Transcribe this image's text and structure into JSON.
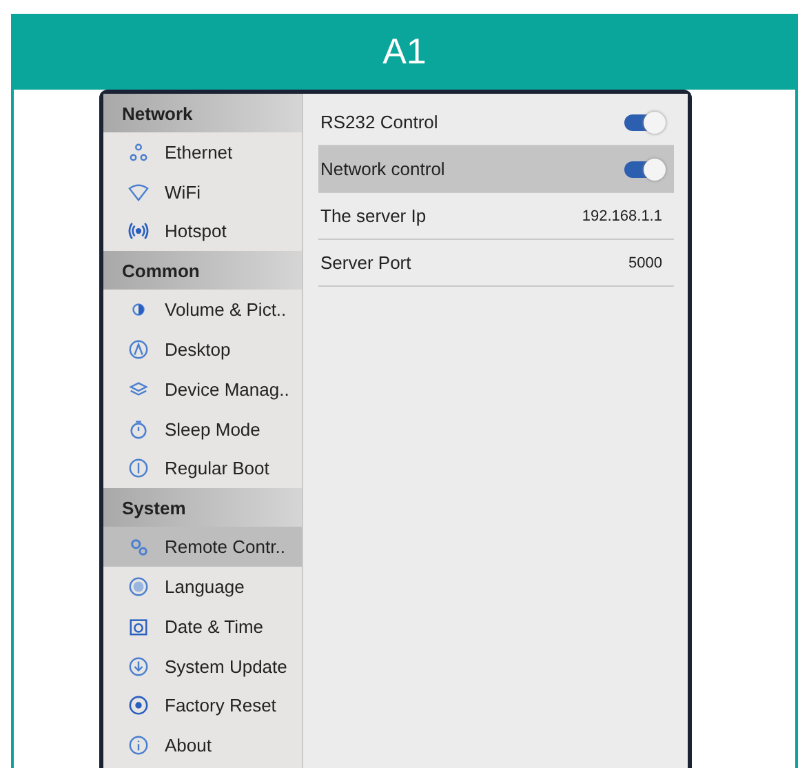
{
  "header": {
    "title": "A1"
  },
  "sidebar": {
    "groups": [
      {
        "title": "Network",
        "items": [
          {
            "label": "Ethernet",
            "selected": false
          },
          {
            "label": "WiFi",
            "selected": false
          },
          {
            "label": "Hotspot",
            "selected": false
          }
        ]
      },
      {
        "title": "Common",
        "items": [
          {
            "label": "Volume & Pict..",
            "selected": false
          },
          {
            "label": "Desktop",
            "selected": false
          },
          {
            "label": "Device Manag..",
            "selected": false
          },
          {
            "label": "Sleep Mode",
            "selected": false
          },
          {
            "label": "Regular Boot",
            "selected": false
          }
        ]
      },
      {
        "title": "System",
        "items": [
          {
            "label": "Remote Contr..",
            "selected": true
          },
          {
            "label": "Language",
            "selected": false
          },
          {
            "label": "Date & Time",
            "selected": false
          },
          {
            "label": "System Update",
            "selected": false
          },
          {
            "label": "Factory Reset",
            "selected": false
          },
          {
            "label": "About",
            "selected": false
          }
        ]
      }
    ]
  },
  "settings": [
    {
      "kind": "toggle",
      "label": "RS232 Control",
      "on": true,
      "selected": false
    },
    {
      "kind": "toggle",
      "label": "Network control",
      "on": true,
      "selected": true
    },
    {
      "kind": "value",
      "label": "The server Ip",
      "value": "192.168.1.1",
      "selected": false
    },
    {
      "kind": "value",
      "label": "Server Port",
      "value": "5000",
      "selected": false
    }
  ]
}
